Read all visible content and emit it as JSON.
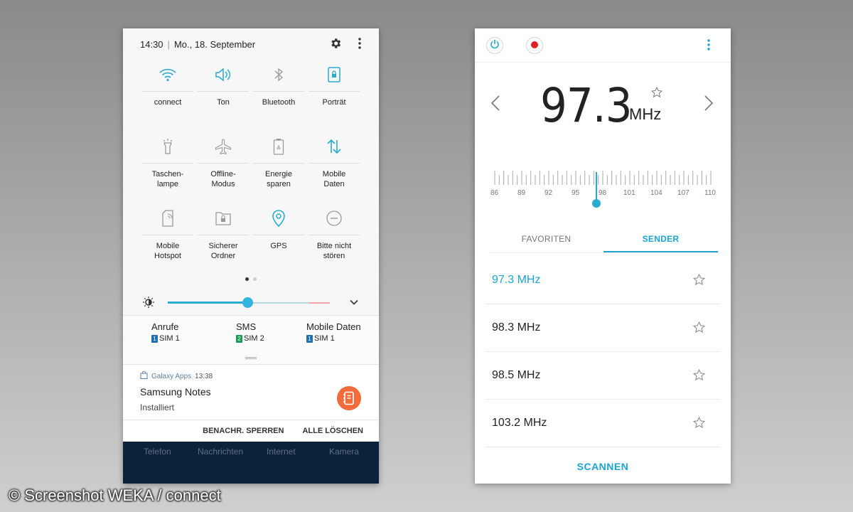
{
  "left": {
    "header": {
      "time": "14:30",
      "date": "Mo., 18. September"
    },
    "tiles": [
      {
        "label": "connect",
        "icon": "wifi-icon",
        "active": true
      },
      {
        "label": "Ton",
        "icon": "sound-icon",
        "active": true
      },
      {
        "label": "Bluetooth",
        "icon": "bluetooth-icon",
        "active": false
      },
      {
        "label": "Porträt",
        "icon": "portrait-lock-icon",
        "active": true
      },
      {
        "label": "Taschen-\nlampe",
        "icon": "flashlight-icon",
        "active": false
      },
      {
        "label": "Offline-\nModus",
        "icon": "airplane-icon",
        "active": false
      },
      {
        "label": "Energie\nsparen",
        "icon": "battery-saver-icon",
        "active": false
      },
      {
        "label": "Mobile\nDaten",
        "icon": "mobile-data-icon",
        "active": true
      },
      {
        "label": "Mobile\nHotspot",
        "icon": "hotspot-icon",
        "active": false
      },
      {
        "label": "Sicherer\nOrdner",
        "icon": "secure-folder-icon",
        "active": false
      },
      {
        "label": "GPS",
        "icon": "location-icon",
        "active": true
      },
      {
        "label": "Bitte nicht\nstören",
        "icon": "do-not-disturb-icon",
        "active": false
      }
    ],
    "brightness": 0.49,
    "sim": [
      {
        "title": "Anrufe",
        "badge": "1",
        "sim": "SIM 1"
      },
      {
        "title": "SMS",
        "badge": "2",
        "sim": "SIM 2"
      },
      {
        "title": "Mobile Daten",
        "badge": "1",
        "sim": "SIM 1"
      }
    ],
    "notification": {
      "app": "Galaxy Apps",
      "time": "13:38",
      "title": "Samsung Notes",
      "text": "Installiert"
    },
    "actions": {
      "block": "BENACHR. SPERREN",
      "clear": "ALLE LÖSCHEN"
    },
    "dock": [
      "Telefon",
      "Nachrichten",
      "Internet",
      "Kamera"
    ]
  },
  "right": {
    "frequency": "97.3",
    "unit": "MHz",
    "dial_labels": [
      "86",
      "89",
      "92",
      "95",
      "98",
      "101",
      "104",
      "107",
      "110"
    ],
    "tabs": {
      "favorites": "FAVORITEN",
      "stations": "SENDER"
    },
    "stations": [
      "97.3 MHz",
      "98.3 MHz",
      "98.5 MHz",
      "103.2 MHz"
    ],
    "scan": "SCANNEN"
  },
  "colors": {
    "accent": "#1aa5d3",
    "record": "#e0201f",
    "dock": "#0c223a",
    "notes_icon": "#f26b3a"
  },
  "watermark": "© Screenshot WEKA / connect"
}
